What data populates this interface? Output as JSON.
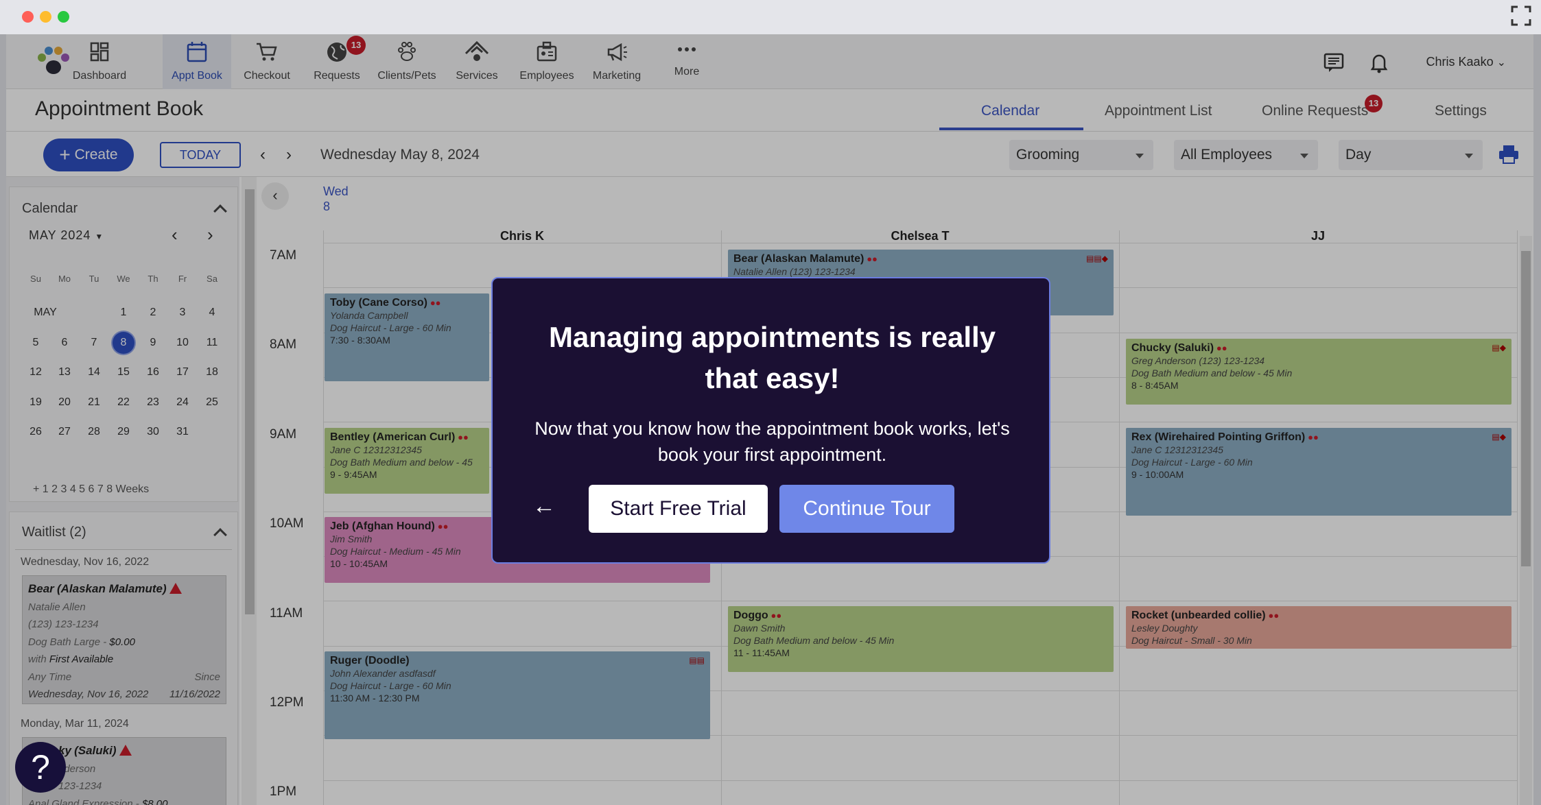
{
  "nav": {
    "items": [
      {
        "label": "Dashboard",
        "icon": "dashboard-icon"
      },
      {
        "label": "Appt Book",
        "icon": "calendar-icon"
      },
      {
        "label": "Checkout",
        "icon": "cart-icon"
      },
      {
        "label": "Requests",
        "icon": "globe-icon",
        "badge": "13"
      },
      {
        "label": "Clients/Pets",
        "icon": "paw-icon"
      },
      {
        "label": "Services",
        "icon": "services-icon"
      },
      {
        "label": "Employees",
        "icon": "employees-icon"
      },
      {
        "label": "Marketing",
        "icon": "megaphone-icon"
      },
      {
        "label": "More",
        "icon": "more-icon"
      }
    ],
    "user": "Chris Kaako"
  },
  "header": {
    "title": "Appointment Book",
    "tabs": [
      {
        "label": "Calendar"
      },
      {
        "label": "Appointment List"
      },
      {
        "label": "Online Requests",
        "badge": "13"
      },
      {
        "label": "Settings"
      }
    ]
  },
  "toolbar": {
    "create": "Create",
    "today": "TODAY",
    "date": "Wednesday May 8, 2024",
    "service_filter": "Grooming",
    "employee_filter": "All Employees",
    "view": "Day"
  },
  "calendar": {
    "title": "Calendar",
    "month": "MAY 2024",
    "dow": [
      "Su",
      "Mo",
      "Tu",
      "We",
      "Th",
      "Fr",
      "Sa"
    ],
    "month_label": "MAY",
    "selected": "8",
    "weeks_row": "+ 1   2   3   4   5   6   7   8 Weeks"
  },
  "waitlist": {
    "title": "Waitlist (2)",
    "groups": [
      {
        "date": "Wednesday, Nov 16, 2022",
        "name": "Bear",
        "breed": "(Alaskan Malamute)",
        "owner": "Natalie Allen",
        "phone": "(123) 123-1234",
        "service": "Dog Bath Large",
        "price": "$0.00",
        "with_label": "with",
        "with_who": "First Available",
        "time_label": "Any Time",
        "since_label": "Since",
        "date_line": "Wednesday, Nov 16, 2022",
        "since_date": "11/16/2022"
      },
      {
        "date": "Monday, Mar 11, 2024",
        "name": "ky",
        "breed": "(Saluki)",
        "owner": "nderson",
        "phone": "123-1234",
        "service": "Anal Gland Expression",
        "price": "$8.00"
      }
    ]
  },
  "grid": {
    "day_name": "Wed",
    "day_num": "8",
    "employees": [
      "Chris K",
      "Chelsea T",
      "JJ"
    ],
    "times": [
      "7AM",
      "8AM",
      "9AM",
      "10AM",
      "11AM",
      "12PM",
      "1PM"
    ]
  },
  "appointments": [
    {
      "pet": "Bear (Alaskan Malamute)",
      "owner": "Natalie Allen (123) 123-1234",
      "service": "",
      "time": ""
    },
    {
      "pet": "Toby (Cane Corso)",
      "owner": "Yolanda Campbell",
      "service": "Dog Haircut - Large - 60 Min",
      "time": "7:30 - 8:30AM"
    },
    {
      "pet": "Chucky (Saluki)",
      "owner": "Greg Anderson (123) 123-1234",
      "service": "Dog Bath Medium and below - 45 Min",
      "time": "8 - 8:45AM"
    },
    {
      "pet": "Bentley (American Curl)",
      "owner": "Jane C 12312312345",
      "service": "Dog Bath Medium and below - 45",
      "time": "9 - 9:45AM"
    },
    {
      "pet": "Rex (Wirehaired Pointing Griffon)",
      "owner": "Jane C 12312312345",
      "service": "Dog Haircut - Large - 60 Min",
      "time": "9 - 10:00AM"
    },
    {
      "pet": "Jeb (Afghan Hound)",
      "owner": "Jim Smith",
      "service": "Dog Haircut - Medium - 45 Min",
      "time": "10 - 10:45AM"
    },
    {
      "pet": "Doggo",
      "owner": "Dawn Smith",
      "service": "Dog Bath Medium and below - 45 Min",
      "time": "11 - 11:45AM"
    },
    {
      "pet": "Rocket (unbearded collie)",
      "owner": "Lesley Doughty",
      "service": "Dog Haircut - Small - 30 Min",
      "time": ""
    },
    {
      "pet": "Ruger (Doodle)",
      "owner": "John Alexander asdfasdf",
      "service": "Dog Haircut - Large - 60 Min",
      "time": "11:30 AM - 12:30 PM"
    }
  ],
  "modal": {
    "title": "Managing appointments is really that easy!",
    "body": "Now that you know how the appointment book works, let's book your first appointment.",
    "back": "←",
    "trial": "Start Free Trial",
    "continue": "Continue Tour"
  },
  "help": "?"
}
